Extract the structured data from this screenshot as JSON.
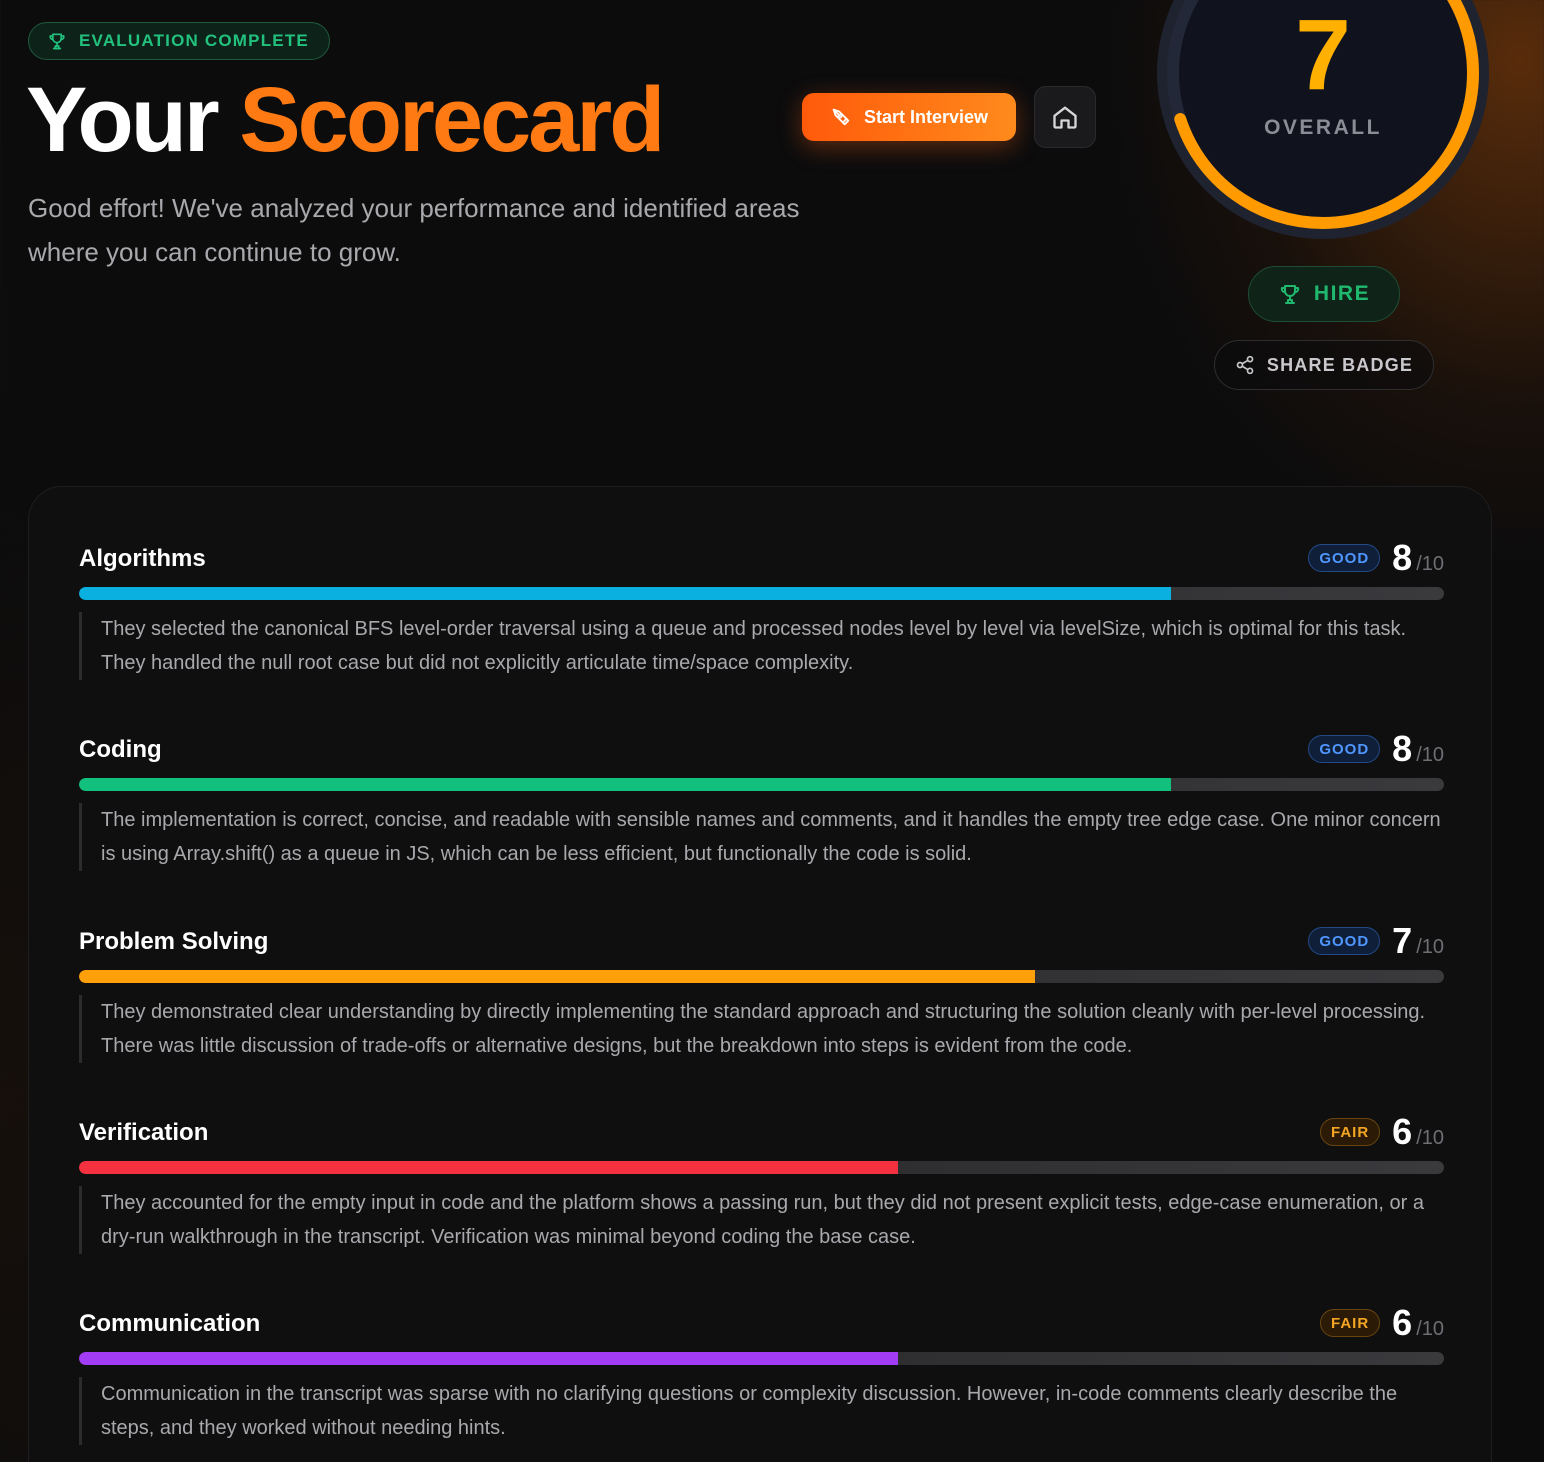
{
  "header": {
    "status_badge": "EVALUATION COMPLETE",
    "title_part1": "Your",
    "title_part2": "Scorecard",
    "subtitle": "Good effort! We've analyzed your performance and identified areas where you can continue to grow.",
    "start_button": "Start Interview"
  },
  "overall": {
    "score": "7",
    "max_score": 10,
    "label": "OVERALL",
    "verdict": "HIRE",
    "share_label": "SHARE BADGE"
  },
  "metrics": [
    {
      "name": "Algorithms",
      "rating": "GOOD",
      "score": "8",
      "max": "/10",
      "fill": 0.8,
      "color": "#0ab0e0",
      "description": "They selected the canonical BFS level-order traversal using a queue and processed nodes level by level via levelSize, which is optimal for this task. They handled the null root case but did not explicitly articulate time/space complexity."
    },
    {
      "name": "Coding",
      "rating": "GOOD",
      "score": "8",
      "max": "/10",
      "fill": 0.8,
      "color": "#10c07c",
      "description": "The implementation is correct, concise, and readable with sensible names and comments, and it handles the empty tree edge case. One minor concern is using Array.shift() as a queue in JS, which can be less efficient, but functionally the code is solid."
    },
    {
      "name": "Problem Solving",
      "rating": "GOOD",
      "score": "7",
      "max": "/10",
      "fill": 0.7,
      "color": "#ff9f0a",
      "description": "They demonstrated clear understanding by directly implementing the standard approach and structuring the solution cleanly with per-level processing. There was little discussion of trade-offs or alternative designs, but the breakdown into steps is evident from the code."
    },
    {
      "name": "Verification",
      "rating": "FAIR",
      "score": "6",
      "max": "/10",
      "fill": 0.6,
      "color": "#f5313f",
      "description": "They accounted for the empty input in code and the platform shows a passing run, but they did not present explicit tests, edge-case enumeration, or a dry-run walkthrough in the transcript. Verification was minimal beyond coding the base case."
    },
    {
      "name": "Communication",
      "rating": "FAIR",
      "score": "6",
      "max": "/10",
      "fill": 0.6,
      "color": "#a23cf5",
      "description": "Communication in the transcript was sparse with no clarifying questions or complexity discussion. However, in-code comments clearly describe the steps, and they worked without needing hints."
    }
  ]
}
